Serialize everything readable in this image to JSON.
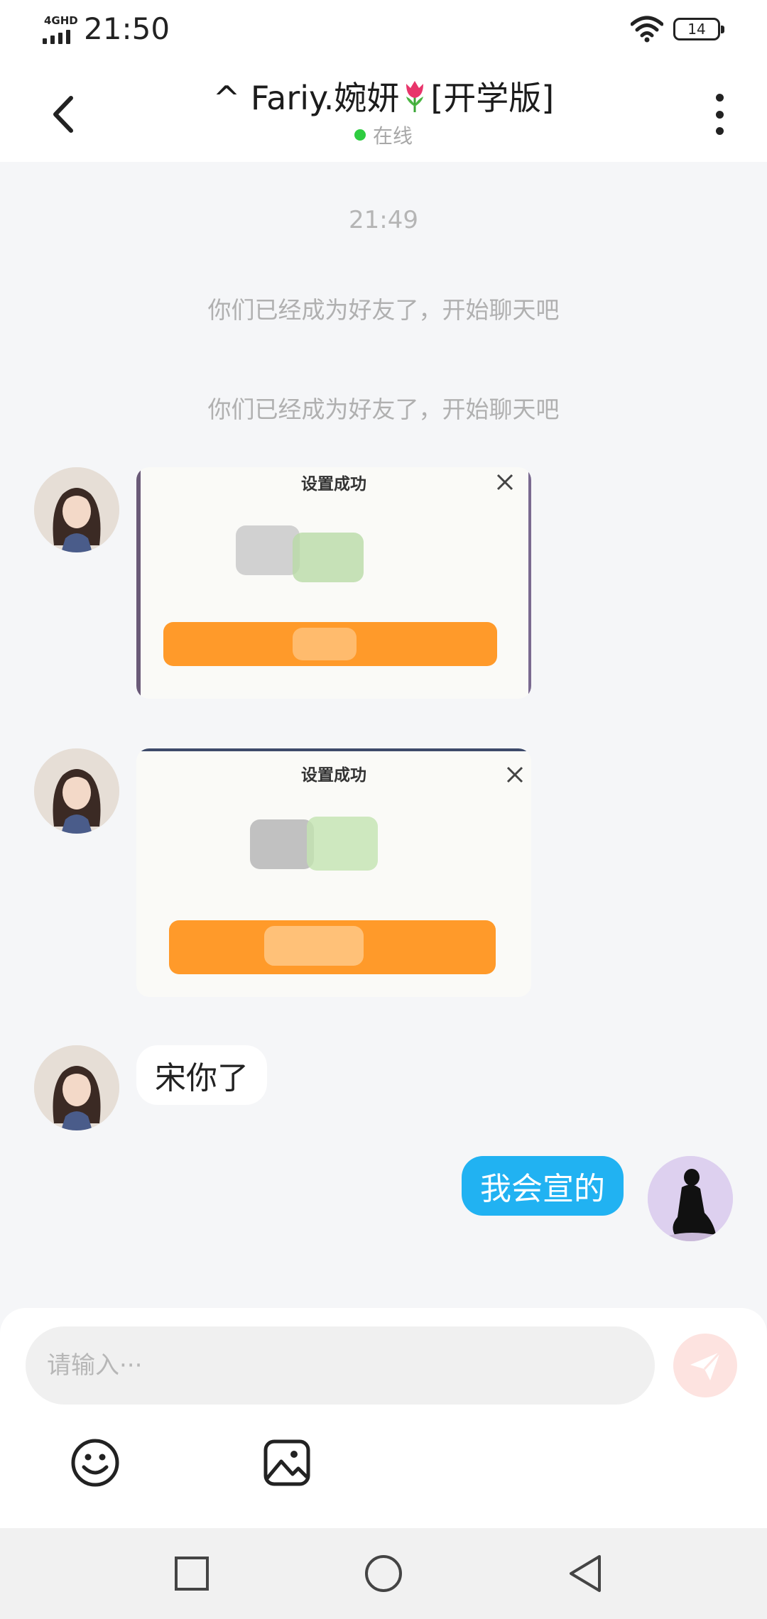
{
  "status_bar": {
    "network": "4GHD",
    "time": "21:50",
    "battery": "14"
  },
  "header": {
    "title_prefix": "^ Fariy.婉妍",
    "title_suffix": "[开学版]",
    "status": "在线"
  },
  "chat": {
    "timestamp": "21:49",
    "system_messages": [
      "你们已经成为好友了，开始聊天吧",
      "你们已经成为好友了，开始聊天吧"
    ],
    "image_messages": [
      {
        "popup_title": "设置成功"
      },
      {
        "popup_title": "设置成功"
      }
    ],
    "incoming_text": "宋你了",
    "outgoing_text": "我会宣的"
  },
  "composer": {
    "placeholder": "请输入···"
  },
  "colors": {
    "accent_blue": "#21b2f2",
    "online_green": "#2ecc40",
    "orange": "#ff9a2a",
    "send_disabled": "#fde3e0"
  },
  "icons": [
    "signal-icon",
    "wifi-icon",
    "battery-icon",
    "back-arrow-icon",
    "tulip-emoji",
    "more-icon",
    "close-icon",
    "send-icon",
    "emoji-icon",
    "image-icon",
    "nav-recents-icon",
    "nav-home-icon",
    "nav-back-icon"
  ]
}
